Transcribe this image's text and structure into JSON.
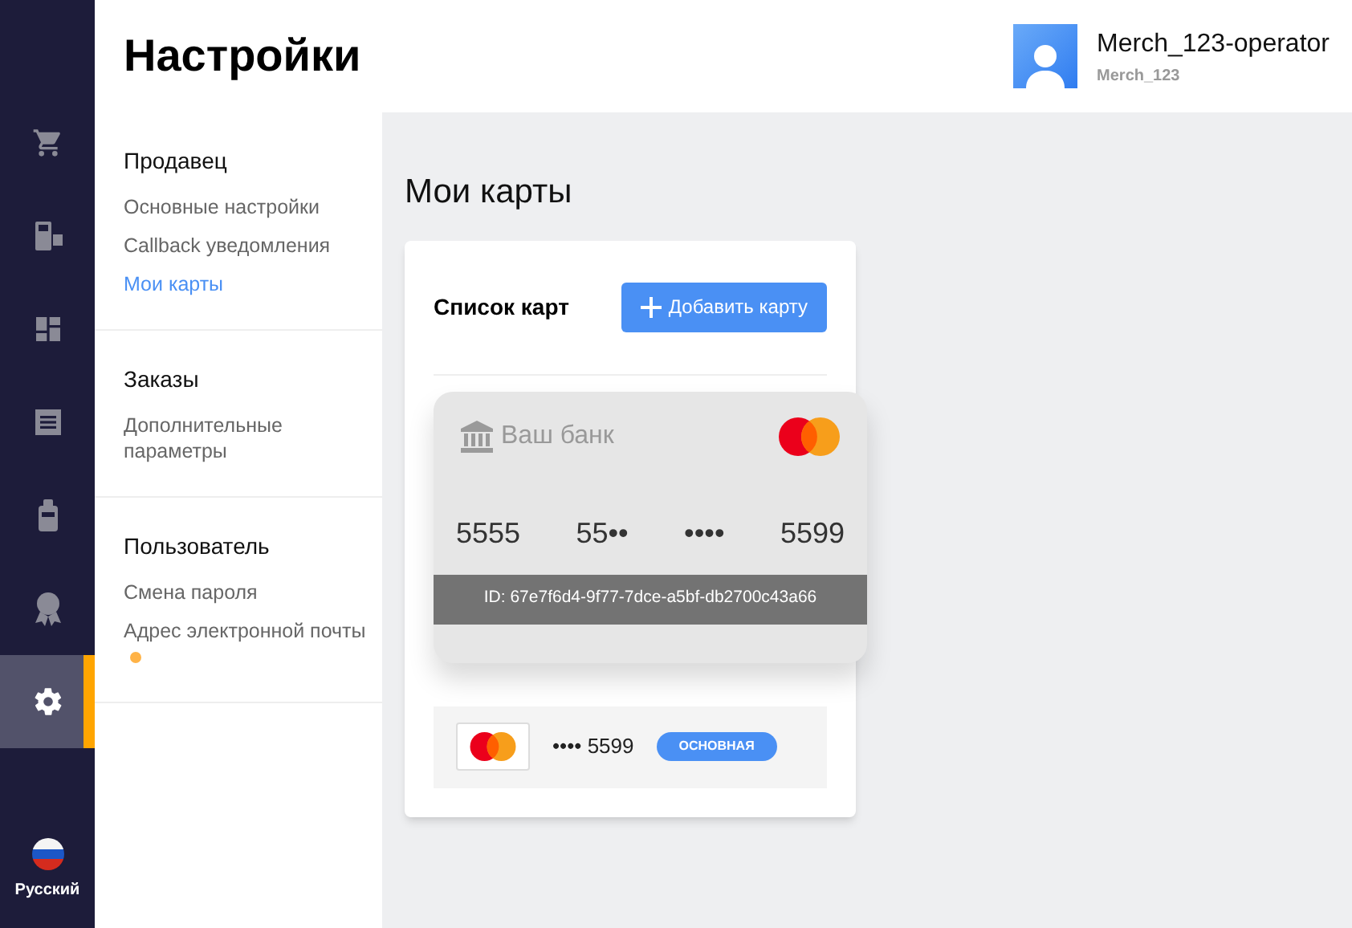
{
  "rail": {
    "items": [
      {
        "kind": "cart",
        "selected": false
      },
      {
        "kind": "terminal",
        "selected": false
      },
      {
        "kind": "dashboard",
        "selected": false
      },
      {
        "kind": "receipt",
        "selected": false
      },
      {
        "kind": "device",
        "selected": false
      },
      {
        "kind": "award",
        "selected": false
      },
      {
        "kind": "settings",
        "selected": true
      }
    ],
    "language": "Русский"
  },
  "header": {
    "title": "Настройки",
    "user": {
      "name": "Merch_123-operator",
      "merchant": "Merch_123"
    }
  },
  "menu": [
    {
      "title": "Продавец",
      "items": [
        {
          "label": "Основные настройки",
          "selected": false,
          "dot": false
        },
        {
          "label": "Callback уведомления",
          "selected": false,
          "dot": false
        },
        {
          "label": "Мои карты",
          "selected": true,
          "dot": false
        }
      ]
    },
    {
      "title": "Заказы",
      "items": [
        {
          "label": "Дополнительные параметры",
          "selected": false,
          "dot": false
        }
      ]
    },
    {
      "title": "Пользователь",
      "items": [
        {
          "label": "Смена пароля",
          "selected": false,
          "dot": false
        },
        {
          "label": "Адрес электронной почты",
          "selected": false,
          "dot": true
        }
      ]
    }
  ],
  "page_title": "Мои карты",
  "cards_panel": {
    "title": "Список карт",
    "add_button": "Добавить карту",
    "card": {
      "bank": "Ваш банк",
      "number_groups": [
        "5555",
        "55••",
        "••••",
        "5599"
      ],
      "id": "ID: 67e7f6d4-9f77-7dce-a5bf-db2700c43a66"
    },
    "list": [
      {
        "masked": "•••• 5599",
        "badge": "ОСНОВНАЯ"
      }
    ]
  }
}
